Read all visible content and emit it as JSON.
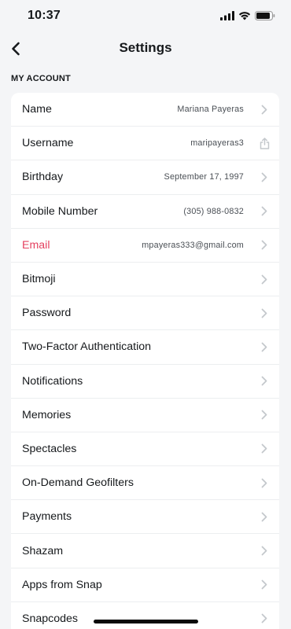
{
  "status_bar": {
    "time": "10:37"
  },
  "nav": {
    "title": "Settings"
  },
  "section": {
    "header": "MY ACCOUNT"
  },
  "rows": [
    {
      "label": "Name",
      "value": "Mariana Payeras",
      "icon": "chevron-right-icon"
    },
    {
      "label": "Username",
      "value": "maripayeras3",
      "icon": "share-icon"
    },
    {
      "label": "Birthday",
      "value": "September 17, 1997",
      "icon": "chevron-right-icon"
    },
    {
      "label": "Mobile Number",
      "value": "(305) 988-0832",
      "icon": "chevron-right-icon"
    },
    {
      "label": "Email",
      "value": "mpayeras333@gmail.com",
      "icon": "chevron-right-icon",
      "highlight": true
    },
    {
      "label": "Bitmoji",
      "value": "",
      "icon": "chevron-right-icon"
    },
    {
      "label": "Password",
      "value": "",
      "icon": "chevron-right-icon"
    },
    {
      "label": "Two-Factor Authentication",
      "value": "",
      "icon": "chevron-right-icon"
    },
    {
      "label": "Notifications",
      "value": "",
      "icon": "chevron-right-icon"
    },
    {
      "label": "Memories",
      "value": "",
      "icon": "chevron-right-icon"
    },
    {
      "label": "Spectacles",
      "value": "",
      "icon": "chevron-right-icon"
    },
    {
      "label": "On-Demand Geofilters",
      "value": "",
      "icon": "chevron-right-icon"
    },
    {
      "label": "Payments",
      "value": "",
      "icon": "chevron-right-icon"
    },
    {
      "label": "Shazam",
      "value": "",
      "icon": "chevron-right-icon"
    },
    {
      "label": "Apps from Snap",
      "value": "",
      "icon": "chevron-right-icon"
    },
    {
      "label": "Snapcodes",
      "value": "",
      "icon": "chevron-right-icon"
    }
  ],
  "colors": {
    "accent": "#e4405f",
    "background": "#f4f5f7",
    "card": "#ffffff",
    "chevron": "#c4c8cc"
  }
}
